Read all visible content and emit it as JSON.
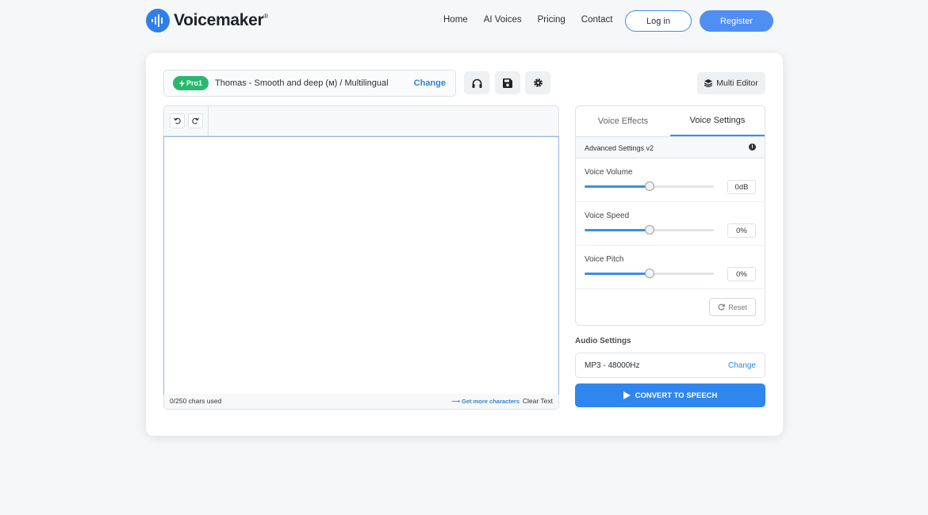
{
  "brand": {
    "name": "Voicemaker",
    "reg": "®",
    "accent": "#2f7fe8"
  },
  "nav": {
    "items": [
      "Home",
      "AI Voices",
      "Pricing",
      "Contact"
    ],
    "login": "Log in",
    "register": "Register"
  },
  "voice": {
    "badge": "Pro1",
    "name": "Thomas - Smooth and deep (ᴍ) / Multilingual",
    "change": "Change"
  },
  "toolbar": {
    "listen_icon": "headphones-icon",
    "save_icon": "save-icon",
    "settings_icon": "gear-icon",
    "multi_editor": "Multi Editor"
  },
  "editor": {
    "chars_used": "0/250 chars used",
    "get_more": "⟶ Get more characters",
    "clear": "Clear Text"
  },
  "panel": {
    "tabs": [
      "Voice Effects",
      "Voice Settings"
    ],
    "active_tab": "Voice Settings",
    "advanced": "Advanced Settings v2",
    "sliders": [
      {
        "label": "Voice Volume",
        "value": "0dB",
        "level": 0.5
      },
      {
        "label": "Voice Speed",
        "value": "0%",
        "level": 0.5
      },
      {
        "label": "Voice Pitch",
        "value": "0%",
        "level": 0.5
      }
    ],
    "reset": "Reset"
  },
  "audio": {
    "title": "Audio Settings",
    "value": "MP3 - 48000Hz",
    "change": "Change"
  },
  "convert": "CONVERT TO SPEECH"
}
